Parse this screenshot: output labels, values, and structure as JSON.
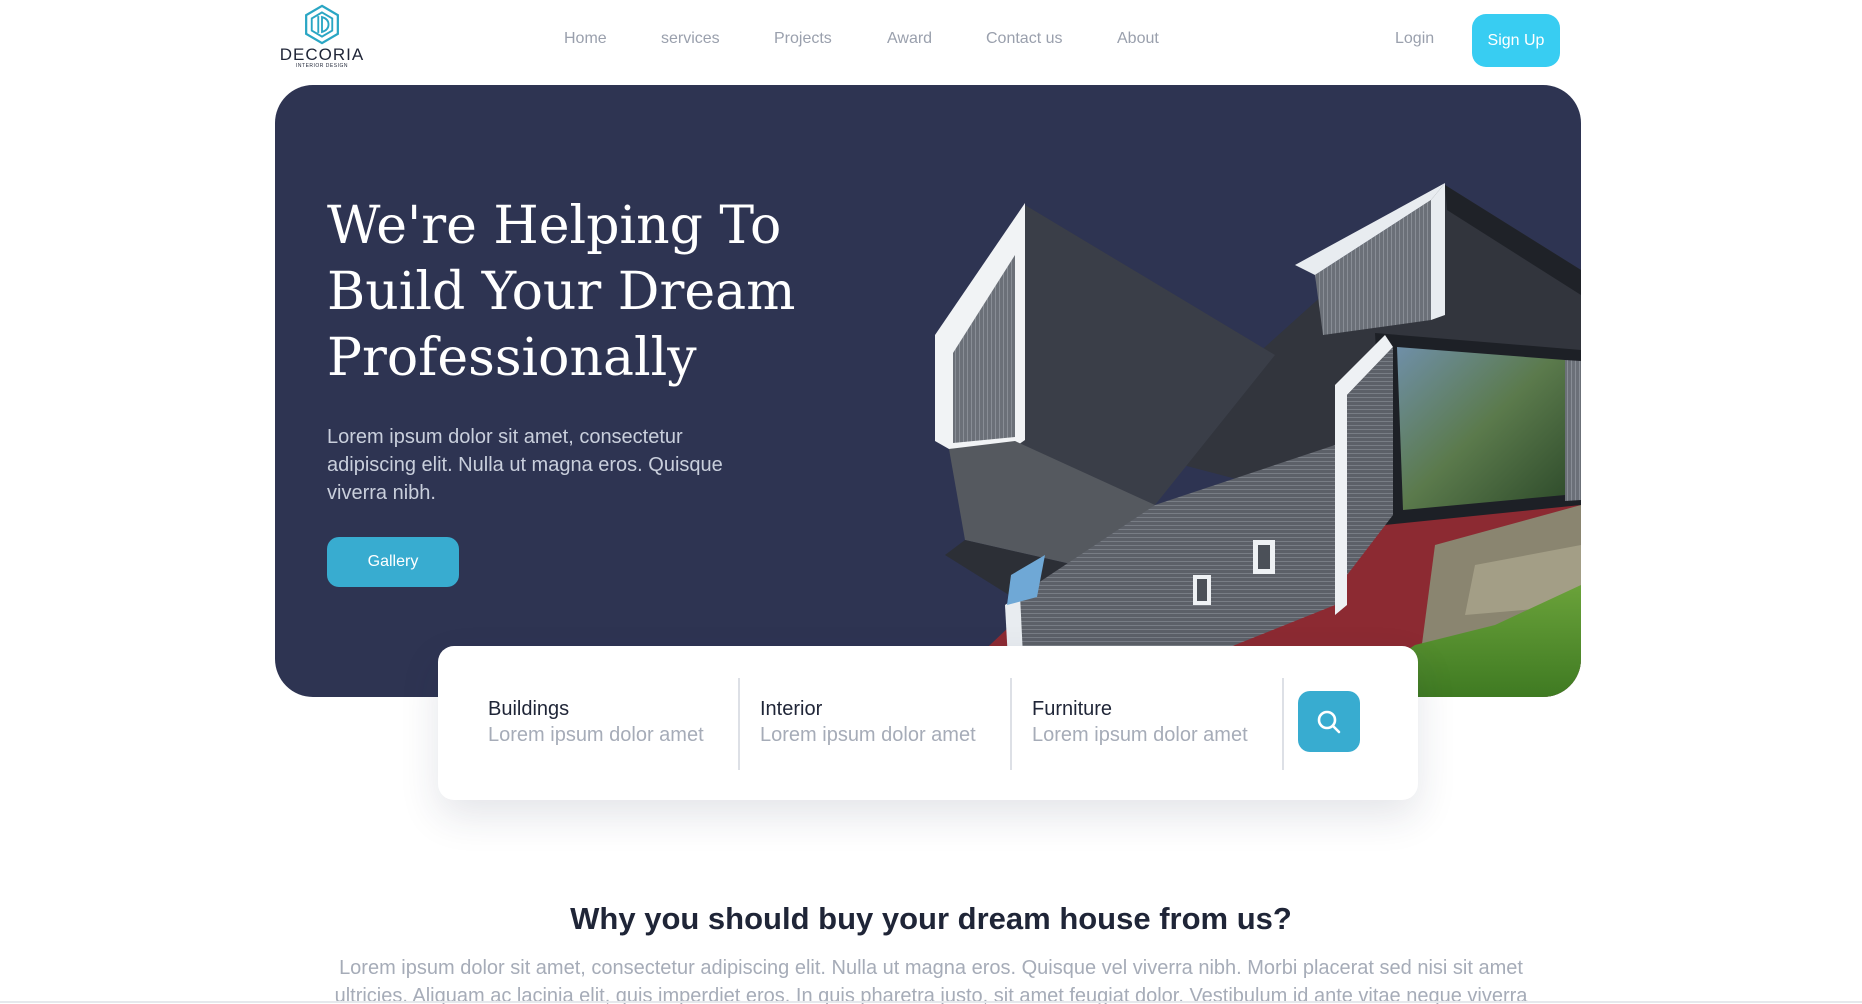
{
  "brand": {
    "name": "DECORIA",
    "tagline": "INTERIOR DESIGN",
    "accent": "#38cdf2"
  },
  "nav": {
    "items": [
      "Home",
      "services",
      "Projects",
      "Award",
      "Contact us",
      "About"
    ],
    "login": "Login",
    "signup": "Sign Up"
  },
  "hero": {
    "title": "We're Helping To Build Your Dream Professionally",
    "description": "Lorem ipsum dolor sit amet, consectetur adipiscing elit. Nulla ut magna eros. Quisque viverra nibh.",
    "cta": "Gallery",
    "background": "#2e3452"
  },
  "search": {
    "categories": [
      {
        "title": "Buildings",
        "subtitle": "Lorem ipsum dolor amet"
      },
      {
        "title": "Interior",
        "subtitle": "Lorem ipsum dolor amet"
      },
      {
        "title": "Furniture",
        "subtitle": "Lorem ipsum dolor amet"
      }
    ],
    "icon": "search-icon"
  },
  "why": {
    "title": "Why you should buy your dream house from us?",
    "text": "Lorem ipsum dolor sit amet, consectetur adipiscing elit. Nulla ut magna eros. Quisque vel viverra nibh. Morbi placerat sed nisi sit amet ultricies. Aliquam ac lacinia elit, quis imperdiet eros. In quis pharetra justo, sit amet feugiat dolor. Vestibulum id ante vitae neque viverra"
  }
}
